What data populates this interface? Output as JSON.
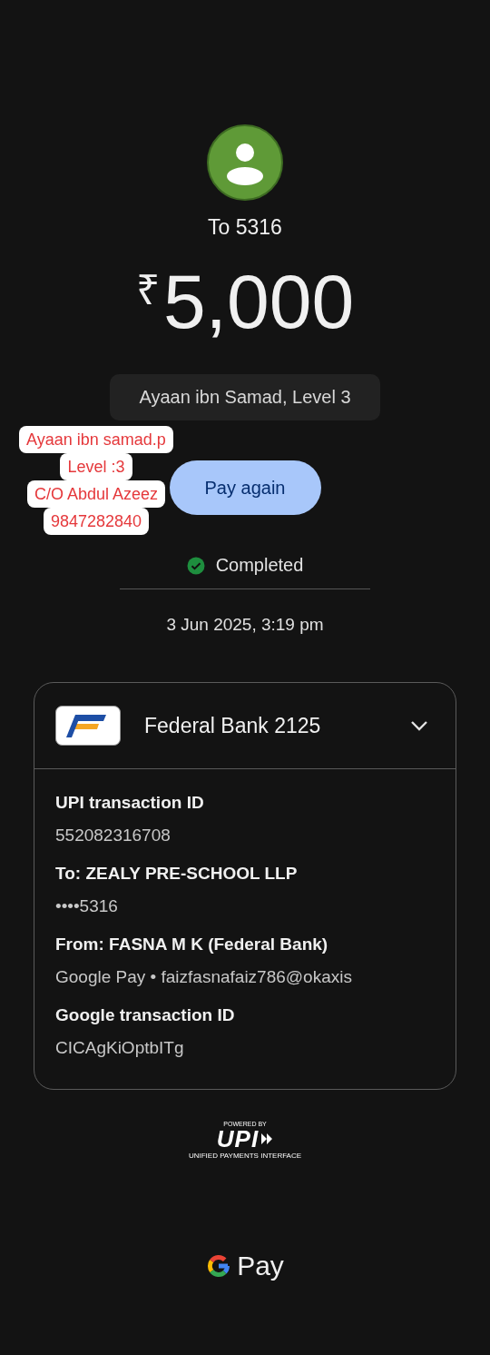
{
  "recipient": {
    "title": "To 5316"
  },
  "amount": {
    "currency": "₹",
    "value": "5,000"
  },
  "note": "Ayaan ibn Samad, Level 3",
  "sticker": {
    "lines": [
      "Ayaan ibn samad.p",
      "Level :3",
      "C/O Abdul Azeez",
      "9847282840"
    ]
  },
  "pay_again": "Pay again",
  "status": {
    "kind": "completed",
    "label": "Completed"
  },
  "datetime": "3 Jun 2025, 3:19 pm",
  "account": {
    "name": "Federal Bank 2125",
    "expanded": true
  },
  "details": [
    {
      "label": "UPI transaction ID",
      "value": "552082316708"
    },
    {
      "label": "To: ZEALY PRE-SCHOOL LLP",
      "value": "••••5316"
    },
    {
      "label": "From: FASNA M K (Federal Bank)",
      "value": "Google Pay • faizfasnafaiz786@okaxis"
    },
    {
      "label": "Google transaction ID",
      "value": "CICAgKiOptbITg"
    }
  ],
  "footer": {
    "powered_by": "POWERED BY",
    "upi": "UPI",
    "upi_sub": "UNIFIED PAYMENTS INTERFACE",
    "brand": "Pay"
  }
}
